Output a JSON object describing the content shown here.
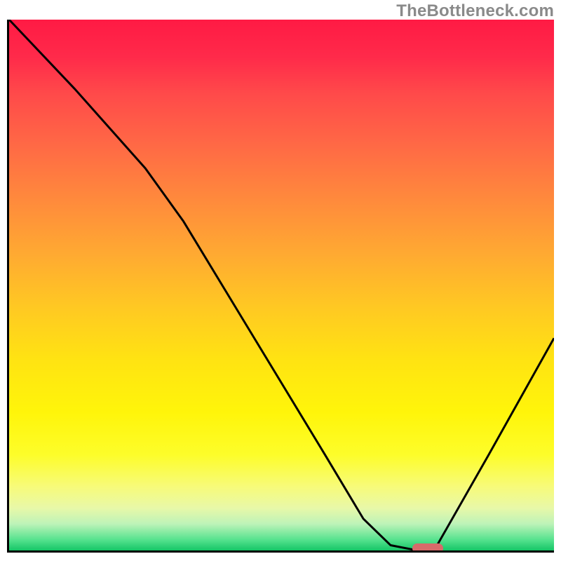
{
  "watermark": "TheBottleneck.com",
  "colors": {
    "frame": "#000000",
    "curve": "#000000",
    "marker": "#d86a6a",
    "gradient_stops": [
      "#ff1a44",
      "#ff2a4a",
      "#ff4a4a",
      "#ff6a45",
      "#ff8a3c",
      "#ffa932",
      "#ffc823",
      "#ffe312",
      "#fff50a",
      "#fdfd2a",
      "#f7fb7a",
      "#e8f8a8",
      "#bdf3b8",
      "#55e28e",
      "#15c566"
    ]
  },
  "chart_data": {
    "type": "line",
    "title": "",
    "xlabel": "",
    "ylabel": "",
    "xlim": [
      0,
      100
    ],
    "ylim": [
      0,
      100
    ],
    "grid": false,
    "legend": false,
    "series": [
      {
        "name": "curve",
        "x": [
          0,
          12,
          25,
          32,
          45,
          58,
          65,
          70,
          75,
          78,
          88,
          100
        ],
        "values": [
          100,
          87,
          72,
          62,
          40,
          18,
          6,
          1,
          0,
          0,
          18,
          40
        ]
      }
    ],
    "minimum_marker": {
      "x": 76.5,
      "y": 0.8
    }
  }
}
